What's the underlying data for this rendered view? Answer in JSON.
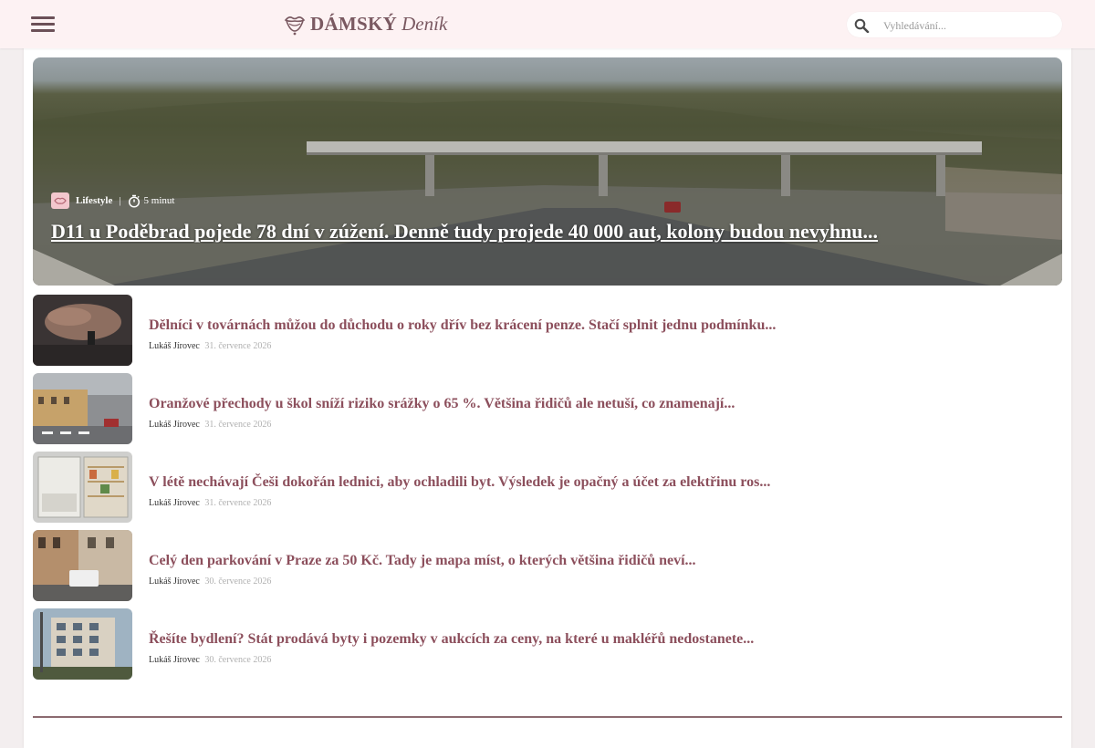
{
  "header": {
    "logo": {
      "word1": "DÁMSKÝ",
      "word2": "Deník"
    },
    "search_placeholder": "Vyhledávání..."
  },
  "hero": {
    "category": "Lifestyle",
    "read_time": "5 minut",
    "title": "D11 u Poděbrad pojede 78 dní v zúžení. Denně tudy projede 40 000 aut, kolony budou nevyhnu..."
  },
  "articles": [
    {
      "title": "Dělníci v továrnách můžou do důchodu o roky dřív bez krácení penze. Stačí splnit jednu podmínku...",
      "author": "Lukáš Jírovec",
      "date": "31. července 2026"
    },
    {
      "title": "Oranžové přechody u škol sníží riziko srážky o 65 %. Většina řidičů ale netuší, co znamenají...",
      "author": "Lukáš Jírovec",
      "date": "31. července 2026"
    },
    {
      "title": "V létě nechávají Češi dokořán lednici, aby ochladili byt. Výsledek je opačný a účet za elektřinu ros...",
      "author": "Lukáš Jírovec",
      "date": "31. července 2026"
    },
    {
      "title": "Celý den parkování v Praze za 50 Kč. Tady je mapa míst, o kterých většina řidičů neví...",
      "author": "Lukáš Jírovec",
      "date": "30. července 2026"
    },
    {
      "title": "Řešíte bydlení? Stát prodává byty i pozemky v aukcích za ceny, na které u makléřů nedostanete...",
      "author": "Lukáš Jírovec",
      "date": "30. července 2026"
    }
  ],
  "icons": {
    "menu": "hamburger-menu-icon",
    "logo": "lips-logo-icon",
    "search": "search-icon",
    "category": "lifestyle-category-icon",
    "time": "stopwatch-icon"
  },
  "colors": {
    "header_bg": "#fdf2f3",
    "accent": "#8c4f5c",
    "logo": "#7a5961",
    "divider": "#8c6a70"
  }
}
